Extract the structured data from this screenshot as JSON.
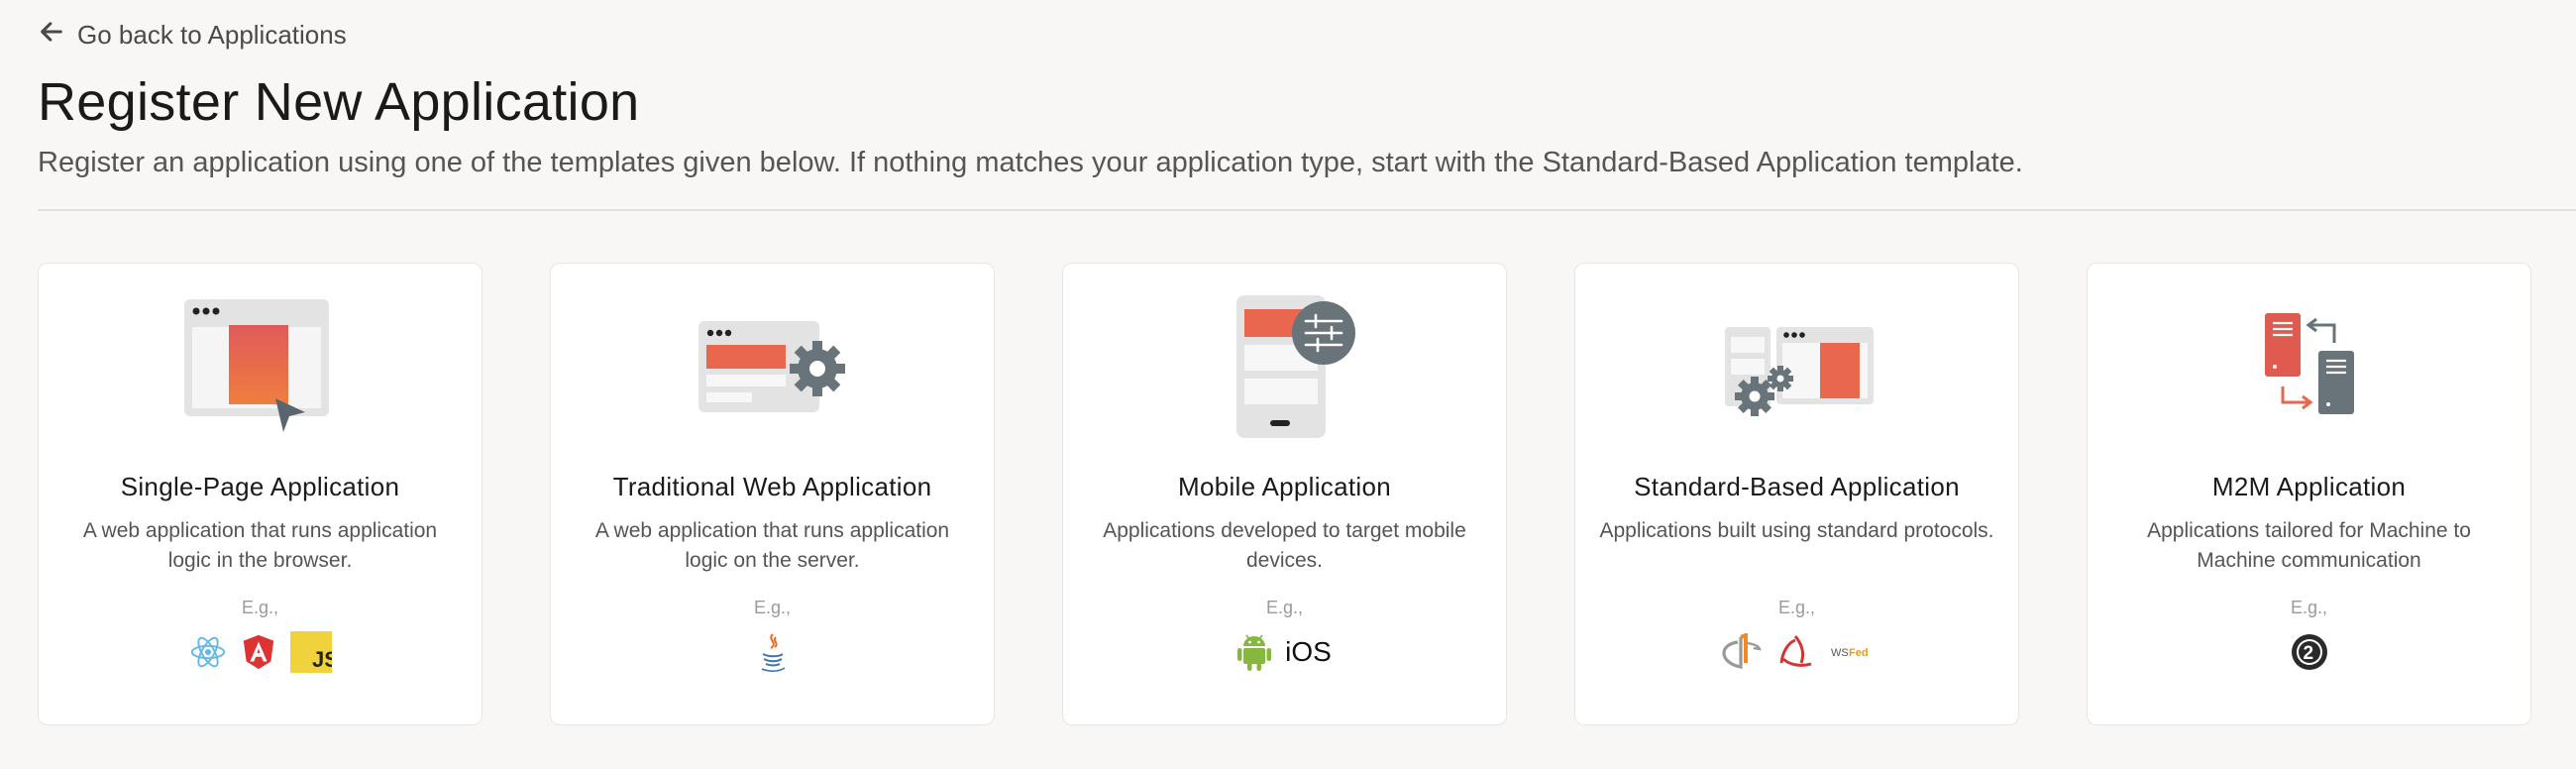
{
  "nav": {
    "back_label": "Go back to Applications",
    "back_icon": "arrow-left-icon"
  },
  "header": {
    "title": "Register New Application",
    "description": "Register an application using one of the templates given below. If nothing matches your application type, start with the Standard-Based Application template."
  },
  "colors": {
    "accent": "#e86a4f",
    "gray": "#6b747a",
    "background": "#f8f7f5"
  },
  "templates": [
    {
      "title": "Single-Page Application",
      "description": "A web application that runs application logic in the browser.",
      "eg": "E.g.,",
      "tech": [
        "react-icon",
        "angular-icon",
        "javascript-icon"
      ]
    },
    {
      "title": "Traditional Web Application",
      "description": "A web application that runs application logic on the server.",
      "eg": "E.g.,",
      "tech": [
        "java-icon"
      ]
    },
    {
      "title": "Mobile Application",
      "description": "Applications developed to target mobile devices.",
      "eg": "E.g.,",
      "tech": [
        "android-icon",
        "ios-label"
      ],
      "ios_label": "iOS"
    },
    {
      "title": "Standard-Based Application",
      "description": "Applications built using standard protocols.",
      "eg": "E.g.,",
      "tech": [
        "openid-icon",
        "saml-icon",
        "wsfed-icon"
      ]
    },
    {
      "title": "M2M Application",
      "description": "Applications tailored for Machine to Machine communication",
      "eg": "E.g.,",
      "tech": [
        "oauth2-icon"
      ]
    }
  ]
}
